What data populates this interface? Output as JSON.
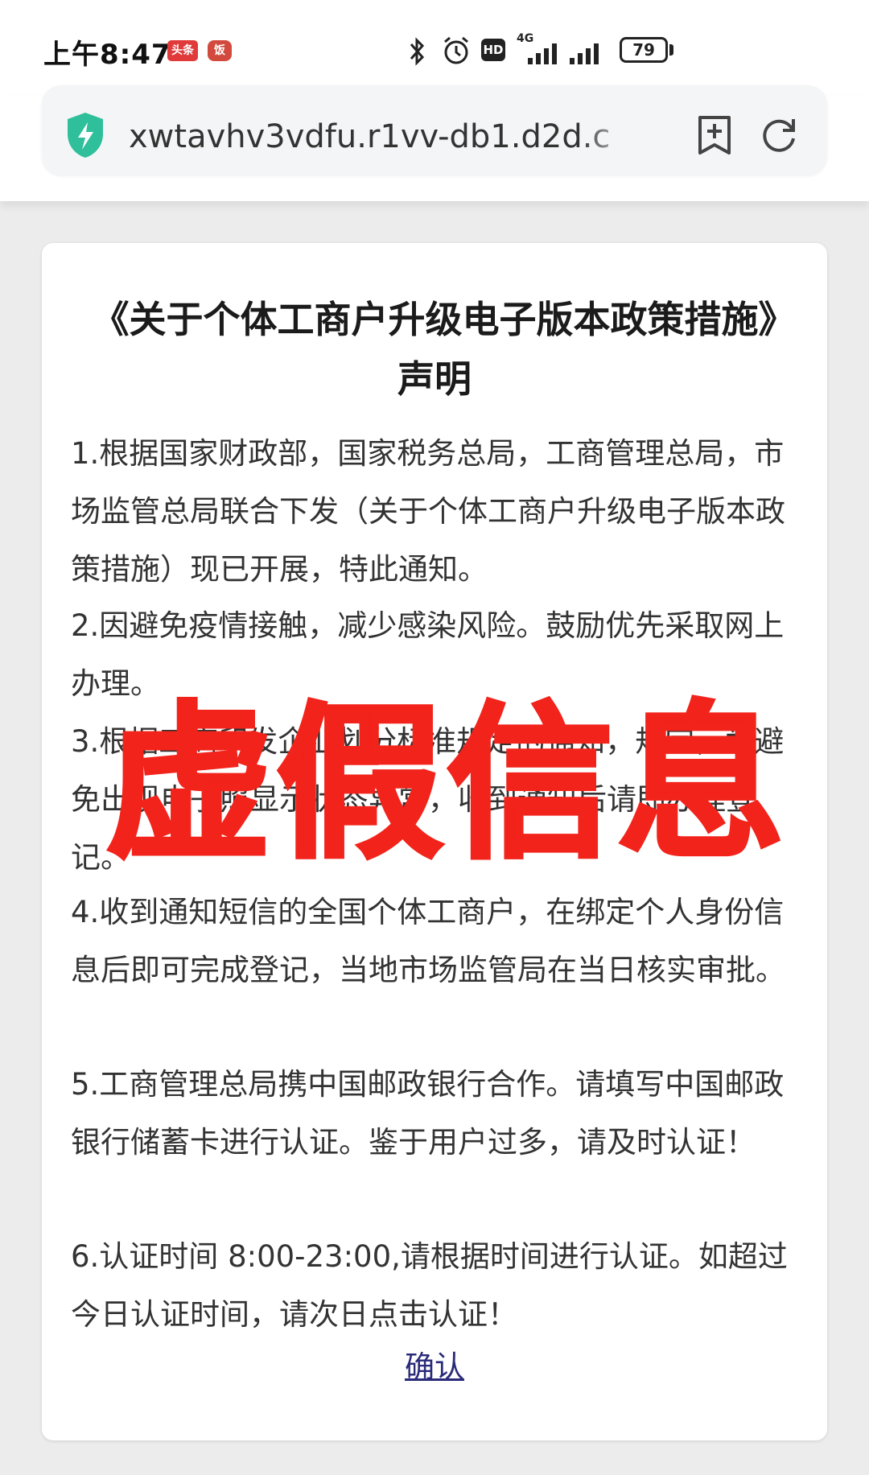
{
  "status_bar": {
    "time": "上午8:47",
    "app_badges": [
      "头条",
      "饭"
    ],
    "battery": "79",
    "network": "4G",
    "hd": "HD"
  },
  "browser": {
    "url": "xwtavhv3vdfu.r1vv-db1.d2d.c",
    "icons": [
      "shield-lightning-icon",
      "bookmark-add-icon",
      "refresh-icon"
    ]
  },
  "notice": {
    "title": "《关于个体工商户升级电子版本政策措施》声明",
    "paragraphs": [
      "1.根据国家财政部，国家税务总局，工商管理总局，市场监管总局联合下发（关于个体工商户升级电子版本政策措施）现已开展，特此通知。",
      "2.因避免疫情接触，减少感染风险。鼓励优先采取网上办理。",
      "3.根据工商印发企业划分标准规定的通知，规定，为避免出现电子照显示状态异常，收到通知后请即办理登记。",
      "4.收到通知短信的全国个体工商户，在绑定个人身份信息后即可完成登记，当地市场监管局在当日核实审批。",
      "5.工商管理总局携中国邮政银行合作。请填写中国邮政银行储蓄卡进行认证。鉴于用户过多，请及时认证！",
      "6.认证时间 8:00-23:00,请根据时间进行认证。如超过今日认证时间，请次日点击认证！"
    ],
    "confirm_label": "确认"
  },
  "overlay": {
    "stamp_text": "虚假信息",
    "color": "#f2231b"
  }
}
